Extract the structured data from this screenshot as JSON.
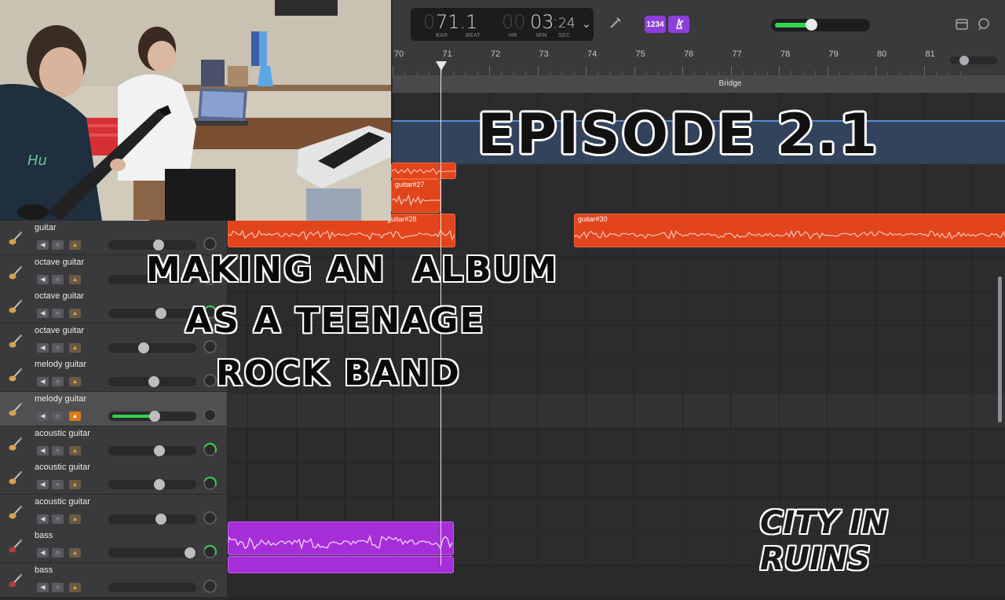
{
  "lcd": {
    "bar_prefix": "0",
    "bar_value": "71.1",
    "bar_label": "BAR",
    "beat_label": "BEAT",
    "hr_value": "00",
    "min_value": "03",
    "sec_value": "24",
    "hr_label": "HR",
    "min_label": "MIN",
    "sec_label": "SEC"
  },
  "toolbar": {
    "count_in_label": "1234",
    "tuner_icon": "tuner-icon",
    "metronome_icon": "metronome-icon",
    "notes_icon": "notes-icon",
    "loops_icon": "loops-icon",
    "master_volume_level": 0.4
  },
  "ruler": {
    "bars": [
      "70",
      "71",
      "72",
      "73",
      "74",
      "75",
      "76",
      "77",
      "78",
      "79",
      "80",
      "81"
    ],
    "marker": "Bridge"
  },
  "regions": {
    "guitar27": "guitar#27",
    "guitar28": "guitar#28",
    "guitar30": "guitar#30"
  },
  "tracks": [
    {
      "name": "guitar",
      "icon": "electric-guitar-icon"
    },
    {
      "name": "octave guitar",
      "icon": "electric-guitar-icon"
    },
    {
      "name": "octave guitar",
      "icon": "electric-guitar-icon"
    },
    {
      "name": "octave guitar",
      "icon": "electric-guitar-icon"
    },
    {
      "name": "melody guitar",
      "icon": "electric-guitar-icon"
    },
    {
      "name": "melody guitar",
      "icon": "electric-guitar-icon"
    },
    {
      "name": "acoustic guitar",
      "icon": "acoustic-guitar-icon"
    },
    {
      "name": "acoustic guitar",
      "icon": "acoustic-guitar-icon"
    },
    {
      "name": "acoustic guitar",
      "icon": "acoustic-guitar-icon"
    },
    {
      "name": "bass",
      "icon": "bass-guitar-icon"
    },
    {
      "name": "bass",
      "icon": "bass-guitar-icon"
    }
  ],
  "overlay": {
    "episode": "EPISODE 2.1",
    "line1": "MAKING AN  ALBUM",
    "line2": "AS A TEENAGE",
    "line3": "ROCK BAND",
    "brand": "CITY IN RUINS"
  },
  "colors": {
    "audio_region": "#e2441c",
    "bass_region": "#a62ed9",
    "fader_green": "#32d64a",
    "accent_purple": "#8d3fdc"
  }
}
